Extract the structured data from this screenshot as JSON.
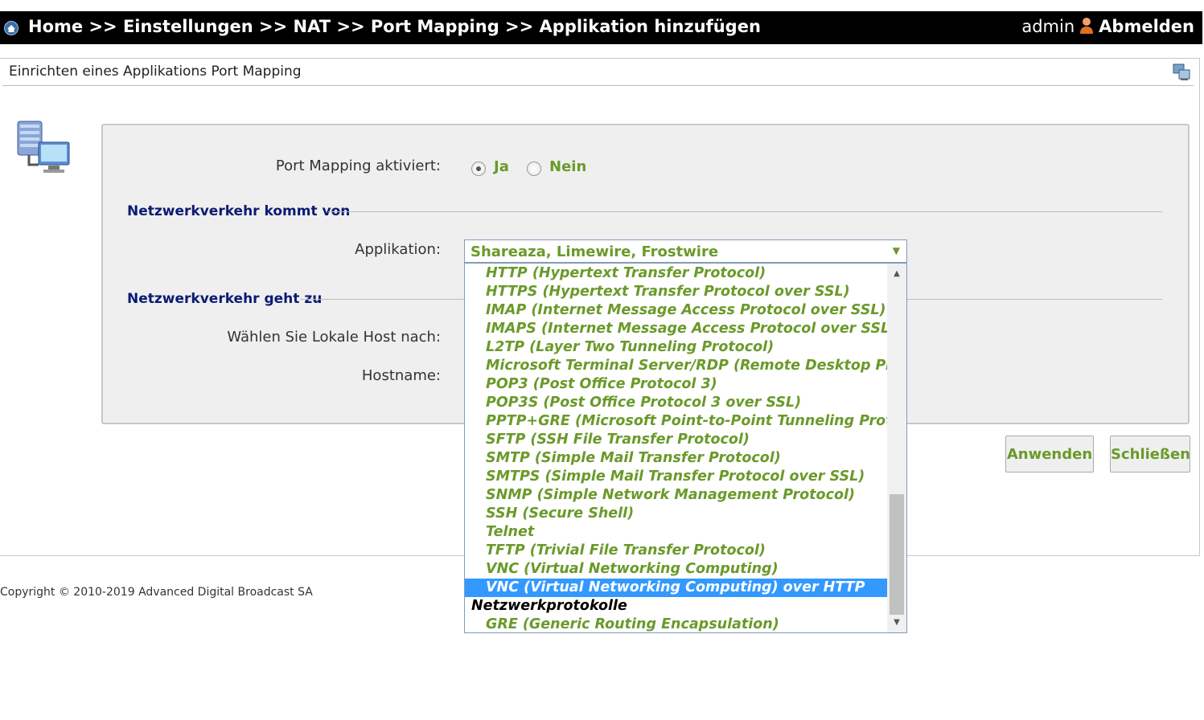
{
  "header": {
    "breadcrumb": "Home >> Einstellungen >> NAT >> Port Mapping >> Applikation hinzufügen",
    "user": "admin",
    "logout": "Abmelden",
    "home_icon": "home-icon",
    "user_icon": "person-icon"
  },
  "panel": {
    "title": "Einrichten eines Applikations Port Mapping",
    "help_icon": "help-icon",
    "network_icon": "network-computer-icon"
  },
  "form": {
    "port_mapping_label": "Port Mapping aktiviert:",
    "radio_yes": "Ja",
    "radio_no": "Nein",
    "radio_selected": "Ja",
    "section_from": "Netzwerkverkehr kommt von",
    "application_label": "Applikation:",
    "application_value": "Shareaza, Limewire, Frostwire",
    "section_to": "Netzwerkverkehr geht zu",
    "local_host_label": "Wählen Sie Lokale Host nach:",
    "hostname_label": "Hostname:"
  },
  "dropdown": {
    "options": [
      "HTTP (Hypertext Transfer Protocol)",
      "HTTPS (Hypertext Transfer Protocol over SSL)",
      "IMAP (Internet Message Access Protocol over SSL)",
      "IMAPS (Internet Message Access Protocol over SSL)",
      "L2TP (Layer Two Tunneling Protocol)",
      "Microsoft Terminal Server/RDP (Remote Desktop Protocol)",
      "POP3 (Post Office Protocol 3)",
      "POP3S (Post Office Protocol 3 over SSL)",
      "PPTP+GRE (Microsoft Point-to-Point Tunneling Protocol)",
      "SFTP (SSH File Transfer Protocol)",
      "SMTP (Simple Mail Transfer Protocol)",
      "SMTPS (Simple Mail Transfer Protocol over SSL)",
      "SNMP (Simple Network Management Protocol)",
      "SSH (Secure Shell)",
      "Telnet",
      "TFTP (Trivial File Transfer Protocol)",
      "VNC (Virtual Networking Computing)",
      "VNC (Virtual Networking Computing) over HTTP"
    ],
    "selected": "VNC (Virtual Networking Computing) over HTTP",
    "group_label": "Netzwerkprotokolle",
    "group_options": [
      "GRE (Generic Routing Encapsulation)"
    ]
  },
  "buttons": {
    "apply": "Anwenden",
    "close": "Schließen"
  },
  "footer": {
    "copyright": "Copyright © 2010-2019 Advanced Digital Broadcast SA"
  },
  "colors": {
    "accent_green": "#6a9a2a",
    "section_blue": "#0a1a73",
    "selection_blue": "#3399ff",
    "header_bg": "#000000"
  }
}
